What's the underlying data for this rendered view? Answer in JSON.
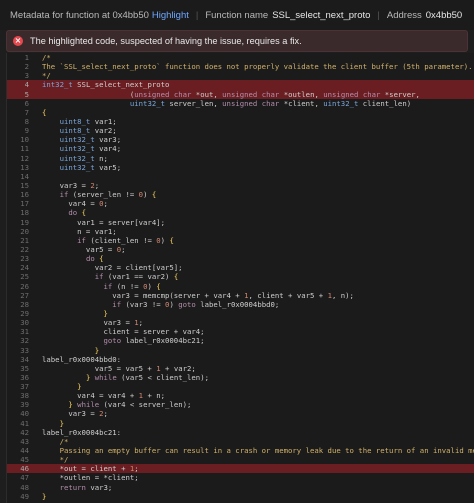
{
  "topbar": {
    "metadata_label": "Metadata for function at 0x4bb50",
    "highlight_label": "Highlight",
    "function_name_label": "Function name",
    "function_name": "SSL_select_next_proto",
    "address_label": "Address",
    "address": "0x4bb50"
  },
  "alert": {
    "icon": "error-icon",
    "message": "The highlighted code, suspected of having the issue, requires a fix."
  },
  "code": {
    "lines": [
      {
        "n": "1",
        "t": "/*"
      },
      {
        "n": "2",
        "t": "The `SSL_select_next_proto` function does not properly validate the client buffer (5th parameter)."
      },
      {
        "n": "3",
        "t": "*/"
      },
      {
        "n": "4",
        "t": "int32_t SSL_select_next_proto",
        "hl": true
      },
      {
        "n": "5",
        "t": "                    (unsigned char *out, unsigned char *outlen, unsigned char *server,",
        "hl": true
      },
      {
        "n": "6",
        "t": "                    uint32_t server_len, unsigned char *client, uint32_t client_len)"
      },
      {
        "n": "7",
        "t": "{"
      },
      {
        "n": "8",
        "t": "    uint8_t var1;"
      },
      {
        "n": "9",
        "t": "    uint8_t var2;"
      },
      {
        "n": "10",
        "t": "    uint32_t var3;"
      },
      {
        "n": "11",
        "t": "    uint32_t var4;"
      },
      {
        "n": "12",
        "t": "    uint32_t n;"
      },
      {
        "n": "13",
        "t": "    uint32_t var5;"
      },
      {
        "n": "14",
        "t": ""
      },
      {
        "n": "15",
        "t": "    var3 = 2;"
      },
      {
        "n": "16",
        "t": "    if (server_len != 0) {"
      },
      {
        "n": "17",
        "t": "      var4 = 0;"
      },
      {
        "n": "18",
        "t": "      do {"
      },
      {
        "n": "19",
        "t": "        var1 = server[var4];"
      },
      {
        "n": "20",
        "t": "        n = var1;"
      },
      {
        "n": "21",
        "t": "        if (client_len != 0) {"
      },
      {
        "n": "22",
        "t": "          var5 = 0;"
      },
      {
        "n": "23",
        "t": "          do {"
      },
      {
        "n": "24",
        "t": "            var2 = client[var5];"
      },
      {
        "n": "25",
        "t": "            if (var1 == var2) {"
      },
      {
        "n": "26",
        "t": "              if (n != 0) {"
      },
      {
        "n": "27",
        "t": "                var3 = memcmp(server + var4 + 1, client + var5 + 1, n);"
      },
      {
        "n": "28",
        "t": "                if (var3 != 0) goto label_r0x0004bbd0;"
      },
      {
        "n": "29",
        "t": "              }"
      },
      {
        "n": "30",
        "t": "              var3 = 1;"
      },
      {
        "n": "31",
        "t": "              client = server + var4;"
      },
      {
        "n": "32",
        "t": "              goto label_r0x0004bc21;"
      },
      {
        "n": "33",
        "t": "            }"
      },
      {
        "n": "34",
        "t": "label_r0x0004bbd0:"
      },
      {
        "n": "35",
        "t": "            var5 = var5 + 1 + var2;"
      },
      {
        "n": "36",
        "t": "          } while (var5 < client_len);"
      },
      {
        "n": "37",
        "t": "        }"
      },
      {
        "n": "38",
        "t": "        var4 = var4 + 1 + n;"
      },
      {
        "n": "39",
        "t": "      } while (var4 < server_len);"
      },
      {
        "n": "40",
        "t": "      var3 = 2;"
      },
      {
        "n": "41",
        "t": "    }"
      },
      {
        "n": "42",
        "t": "label_r0x0004bc21:"
      },
      {
        "n": "43",
        "t": "    /*"
      },
      {
        "n": "44",
        "t": "    Passing an empty buffer can result in a crash or memory leak due to the return of an invalid memory pointer."
      },
      {
        "n": "45",
        "t": "    */"
      },
      {
        "n": "46",
        "t": "    *out = client + 1;",
        "hl": true
      },
      {
        "n": "47",
        "t": "    *outlen = *client;"
      },
      {
        "n": "48",
        "t": "    return var3;"
      },
      {
        "n": "49",
        "t": "}"
      }
    ]
  }
}
